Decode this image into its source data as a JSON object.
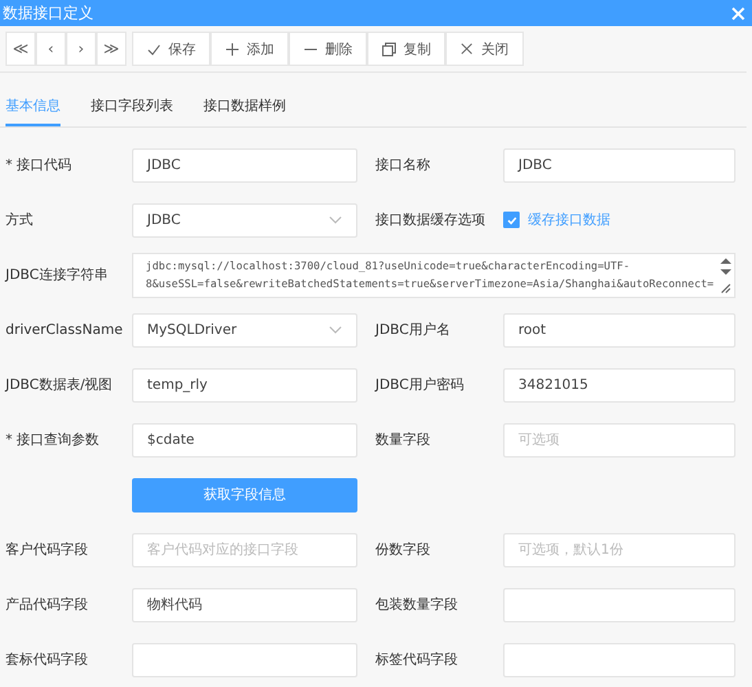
{
  "window": {
    "title": "数据接口定义"
  },
  "nav_buttons": [
    "≪",
    "‹",
    "›",
    "≫"
  ],
  "toolbar": [
    {
      "kind": "save",
      "label": "保存"
    },
    {
      "kind": "add",
      "label": "添加"
    },
    {
      "kind": "delete",
      "label": "删除"
    },
    {
      "kind": "copy",
      "label": "复制"
    },
    {
      "kind": "close",
      "label": "关闭"
    }
  ],
  "tabs": [
    {
      "label": "基本信息",
      "selected": true
    },
    {
      "label": "接口字段列表",
      "selected": false
    },
    {
      "label": "接口数据样例",
      "selected": false
    }
  ],
  "rows": [
    {
      "kind": "fields",
      "cells": [
        {
          "label": "* 接口代码",
          "kind": "input",
          "value": "JDBC"
        },
        {
          "label": "接口名称",
          "kind": "input",
          "value": "JDBC"
        }
      ]
    },
    {
      "kind": "fields",
      "cells": [
        {
          "label": "方式",
          "kind": "select",
          "value": "JDBC"
        },
        {
          "label": "接口数据缓存选项",
          "kind": "checkbox",
          "option": "缓存接口数据",
          "checked": true
        }
      ]
    },
    {
      "kind": "fields",
      "cells": [
        {
          "label": "JDBC连接字符串",
          "kind": "textarea",
          "value": "jdbc:mysql://localhost:3700/cloud_81?useUnicode=true&characterEncoding=UTF-8&useSSL=false&rewriteBatchedStatements=true&serverTimezone=Asia/Shanghai&autoReconnect="
        }
      ]
    },
    {
      "kind": "fields",
      "cells": [
        {
          "label": "driverClassName",
          "kind": "select",
          "value": "MySQLDriver"
        },
        {
          "label": "JDBC用户名",
          "kind": "input",
          "value": "root"
        }
      ]
    },
    {
      "kind": "fields",
      "cells": [
        {
          "label": "JDBC数据表/视图",
          "kind": "input",
          "value": "temp_rly"
        },
        {
          "label": "JDBC用户密码",
          "kind": "input",
          "value": "34821015"
        }
      ]
    },
    {
      "kind": "fields",
      "cells": [
        {
          "label": "* 接口查询参数",
          "kind": "input",
          "value": "$cdate"
        },
        {
          "label": "数量字段",
          "kind": "input",
          "placeholder": "可选项"
        }
      ]
    },
    {
      "kind": "button",
      "label": "获取字段信息"
    },
    {
      "kind": "fields",
      "cells": [
        {
          "label": "客户代码字段",
          "kind": "input",
          "placeholder": "客户代码对应的接口字段"
        },
        {
          "label": "份数字段",
          "kind": "input",
          "placeholder": "可选项，默认1份"
        }
      ]
    },
    {
      "kind": "fields",
      "cells": [
        {
          "label": "产品代码字段",
          "kind": "input",
          "value": "物料代码"
        },
        {
          "label": "包装数量字段",
          "kind": "input"
        }
      ]
    },
    {
      "kind": "fields",
      "cells": [
        {
          "label": "套标代码字段",
          "kind": "input"
        },
        {
          "label": "标签代码字段",
          "kind": "input"
        }
      ]
    }
  ]
}
